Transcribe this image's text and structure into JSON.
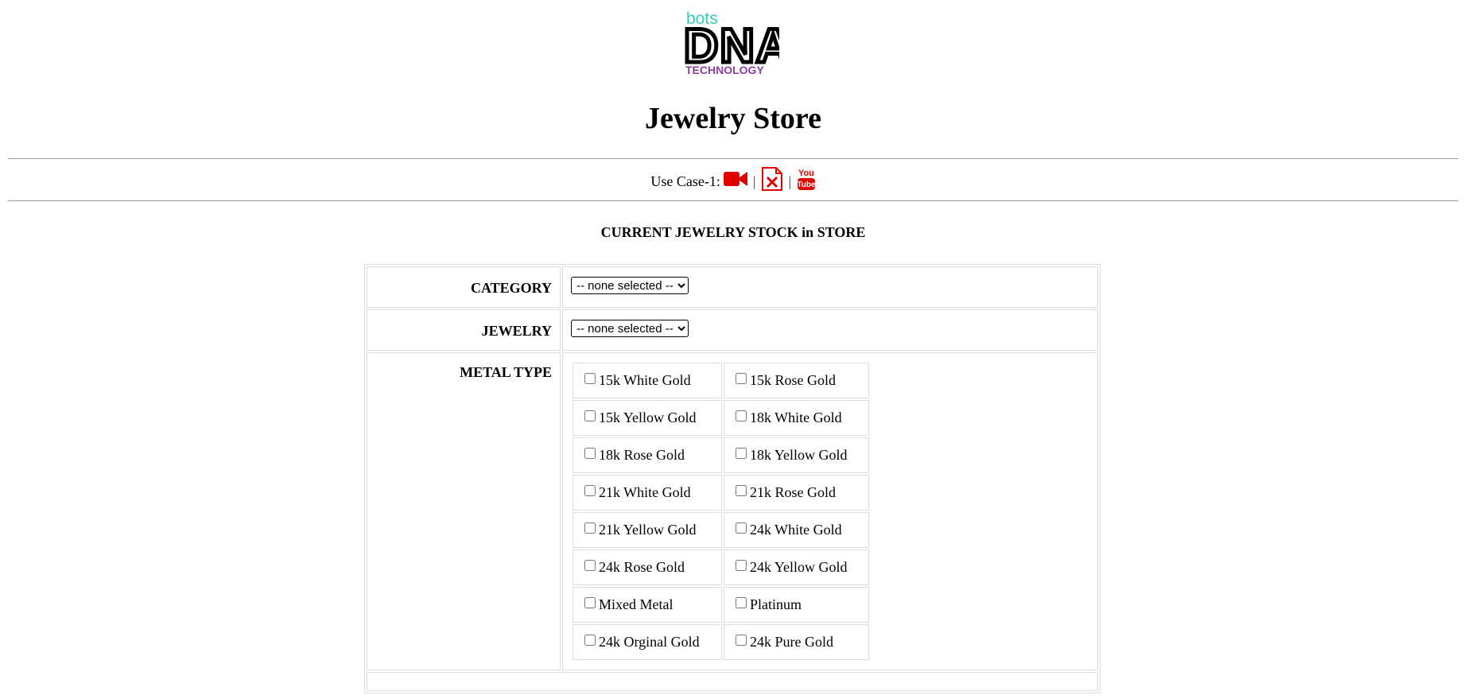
{
  "logo": {
    "top": "bots",
    "main": "DNA",
    "bottom": "TECHNOLOGY"
  },
  "header": {
    "title": "Jewelry Store"
  },
  "usecase": {
    "label": "Use Case-1:",
    "separator": "|",
    "icons": [
      "video-camera-icon",
      "excel-file-icon",
      "youtube-icon"
    ],
    "youtube_text_top": "You",
    "youtube_text_bottom": "Tube"
  },
  "section": {
    "title": "CURRENT JEWELRY STOCK in STORE"
  },
  "form": {
    "category": {
      "label": "CATEGORY",
      "selected": "-- none selected --"
    },
    "jewelry": {
      "label": "JEWELRY",
      "selected": "-- none selected --"
    },
    "metal_type": {
      "label": "METAL TYPE",
      "options": [
        [
          "15k White Gold",
          "15k Rose Gold"
        ],
        [
          "15k Yellow Gold",
          "18k White Gold"
        ],
        [
          "18k Rose Gold",
          "18k Yellow Gold"
        ],
        [
          "21k White Gold",
          "21k Rose Gold"
        ],
        [
          "21k Yellow Gold",
          "24k White Gold"
        ],
        [
          "24k Rose Gold",
          "24k Yellow Gold"
        ],
        [
          "Mixed Metal",
          "Platinum"
        ],
        [
          "24k Orginal Gold",
          "24k Pure Gold"
        ]
      ]
    }
  },
  "colors": {
    "logo_teal": "#3cc8c0",
    "logo_purple": "#8a3fa0",
    "icon_red": "#e00000",
    "border": "#dddddd"
  }
}
